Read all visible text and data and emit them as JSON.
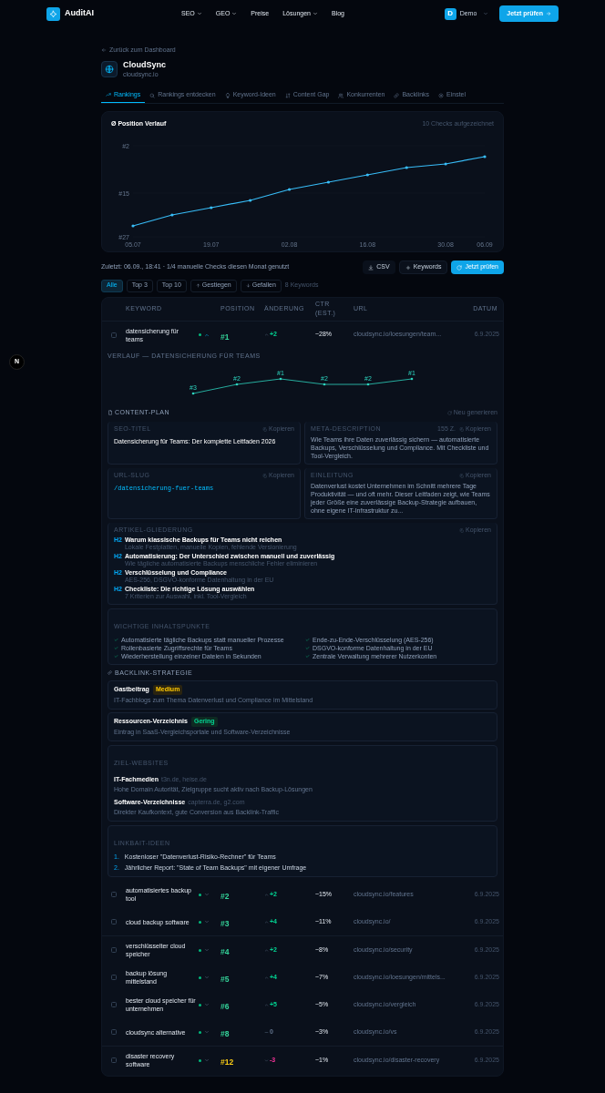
{
  "nav": {
    "brand": "AuditAI",
    "links": [
      {
        "label": "SEO",
        "dropdown": true
      },
      {
        "label": "GEO",
        "dropdown": true
      },
      {
        "label": "Preise",
        "dropdown": false
      },
      {
        "label": "Lösungen",
        "dropdown": true
      },
      {
        "label": "Blog",
        "dropdown": false
      }
    ],
    "avatar": "D",
    "user": "Demo",
    "cta": "Jetzt prüfen"
  },
  "back_link": "Zurück zum Dashboard",
  "project": {
    "name": "CloudSync",
    "domain": "cloudsync.io"
  },
  "tabs": [
    {
      "label": "Rankings",
      "selected": true
    },
    {
      "label": "Rankings entdecken",
      "selected": false
    },
    {
      "label": "Keyword-Ideen",
      "selected": false
    },
    {
      "label": "Content Gap",
      "selected": false
    },
    {
      "label": "Konkurrenten",
      "selected": false
    },
    {
      "label": "Backlinks",
      "selected": false
    },
    {
      "label": "Einstel",
      "selected": false
    }
  ],
  "position_chart": {
    "title": "Ø Position Verlauf",
    "note": "10 Checks aufgezeichnet",
    "chart_data": {
      "type": "line",
      "categories": [
        "05.07",
        null,
        "19.07",
        null,
        "02.08",
        null,
        "16.08",
        null,
        "30.08",
        "06.09"
      ],
      "series": [
        {
          "color": "#38bdf8",
          "values": [
            24,
            21,
            19,
            17,
            14,
            12,
            10,
            8,
            7,
            5
          ]
        }
      ],
      "ylim": [
        27,
        2
      ],
      "yticks": [
        {
          "value": 2,
          "label": "#2"
        },
        {
          "value": 15,
          "label": "#15"
        },
        {
          "value": 27,
          "label": "#27"
        }
      ]
    }
  },
  "toolbar": {
    "status": "Zuletzt: 06.09., 18:41 · 1/4 manuelle Checks diesen Monat genutzt",
    "buttons": [
      {
        "kind": "csv",
        "label": "CSV"
      },
      {
        "kind": "add",
        "label": "Keywords"
      },
      {
        "kind": "primary",
        "label": "Jetzt prüfen"
      }
    ]
  },
  "filters": [
    {
      "label": "Alle",
      "selected": true
    },
    {
      "label": "Top 3",
      "selected": false
    },
    {
      "label": "Top 10",
      "selected": false
    },
    {
      "label": "Gestiegen",
      "selected": false
    },
    {
      "label": "Gefallen",
      "selected": false
    }
  ],
  "keyword_count": "8 Keywords",
  "table": {
    "columns": [
      "KEYWORD",
      "POSITION",
      "ÄNDERUNG",
      "CTR (EST.)",
      "URL",
      "DATUM"
    ],
    "rows": [
      {
        "keyword": "datensicherung für teams",
        "position": "#1",
        "color": "#34d399",
        "kind": "up",
        "change": "+2",
        "ctr": "~28%",
        "url": "cloudsync.io/loesungen/team...",
        "date": "6.9.2025",
        "checked": false,
        "expanded": true
      },
      {
        "keyword": "automatisiertes backup tool",
        "position": "#2",
        "color": "#34d399",
        "kind": "up",
        "change": "+2",
        "ctr": "~15%",
        "url": "cloudsync.io/features",
        "date": "6.9.2025",
        "checked": false,
        "expanded": false
      },
      {
        "keyword": "cloud backup software",
        "position": "#3",
        "color": "#34d399",
        "kind": "up",
        "change": "+4",
        "ctr": "~11%",
        "url": "cloudsync.io/",
        "date": "6.9.2025",
        "checked": false,
        "expanded": false
      },
      {
        "keyword": "verschlüsselter cloud speicher",
        "position": "#4",
        "color": "#34d399",
        "kind": "up",
        "change": "+2",
        "ctr": "~8%",
        "url": "cloudsync.io/security",
        "date": "6.9.2025",
        "checked": false,
        "expanded": false
      },
      {
        "keyword": "backup lösung mittelstand",
        "position": "#5",
        "color": "#34d399",
        "kind": "up",
        "change": "+4",
        "ctr": "~7%",
        "url": "cloudsync.io/loesungen/mittels...",
        "date": "6.9.2025",
        "checked": false,
        "expanded": false
      },
      {
        "keyword": "bester cloud speicher für unternehmen",
        "position": "#6",
        "color": "#34d399",
        "kind": "up",
        "change": "+5",
        "ctr": "~5%",
        "url": "cloudsync.io/vergleich",
        "date": "6.9.2025",
        "checked": false,
        "expanded": false
      },
      {
        "keyword": "cloudsync alternative",
        "position": "#8",
        "color": "#34d399",
        "kind": "flat",
        "change": "0",
        "ctr": "~3%",
        "url": "cloudsync.io/vs",
        "date": "6.9.2025",
        "checked": false,
        "expanded": false
      },
      {
        "keyword": "disaster recovery software",
        "position": "#12",
        "color": "#facc15",
        "kind": "down",
        "change": "-3",
        "ctr": "~1%",
        "url": "cloudsync.io/disaster-recovery",
        "date": "6.9.2025",
        "checked": false,
        "expanded": false
      }
    ]
  },
  "history": {
    "title": "VERLAUF — DATENSICHERUNG FÜR TEAMS",
    "point_labels": [
      "#3",
      "#2",
      "#1",
      "#2",
      "#2",
      "#1"
    ]
  },
  "content_plan": {
    "title": "CONTENT-PLAN",
    "regenerate": "Neu generieren",
    "seo_title": {
      "label": "SEO-TITEL",
      "copy": "Kopieren",
      "text": "Datensicherung für Teams: Der komplette Leitfaden 2026"
    },
    "meta": {
      "label": "META-DESCRIPTION",
      "count": "155 Z.",
      "copy": "Kopieren",
      "text": "Wie Teams ihre Daten zuverlässig sichern — automatisierte Backups, Verschlüsselung und Compliance. Mit Checkliste und Tool-Vergleich."
    },
    "slug": {
      "label": "URL-SLUG",
      "copy": "Kopieren",
      "text": "/datensicherung-fuer-teams"
    },
    "intro": {
      "label": "EINLEITUNG",
      "copy": "Kopieren",
      "text": "Datenverlust kostet Unternehmen im Schnitt mehrere Tage Produktivität — und oft mehr. Dieser Leitfaden zeigt, wie Teams jeder Größe eine zuverlässige Backup-Strategie aufbauen, ohne eigene IT-Infrastruktur zu..."
    },
    "outline": {
      "label": "ARTIKEL-GLIEDERUNG",
      "copy": "Kopieren",
      "items": [
        {
          "tag": "H2",
          "heading": "Warum klassische Backups für Teams nicht reichen",
          "note": "Lokale Festplatten, manuelle Kopien, fehlende Versionierung"
        },
        {
          "tag": "H2",
          "heading": "Automatisierung: Der Unterschied zwischen manuell und zuverlässig",
          "note": "Wie tägliche automatisierte Backups menschliche Fehler eliminieren"
        },
        {
          "tag": "H2",
          "heading": "Verschlüsselung und Compliance",
          "note": "AES-256, DSGVO-konforme Datenhaltung in der EU"
        },
        {
          "tag": "H2",
          "heading": "Checkliste: Die richtige Lösung auswählen",
          "note": "7 Kriterien zur Auswahl, inkl. Tool-Vergleich"
        }
      ]
    },
    "key_points": {
      "label": "WICHTIGE INHALTSPUNKTE",
      "items": [
        "Automatisierte tägliche Backups statt manueller Prozesse",
        "Ende-zu-Ende-Verschlüsselung (AES-256)",
        "Rollenbasierte Zugriffsrechte für Teams",
        "DSGVO-konforme Datenhaltung in der EU",
        "Wiederherstellung einzelner Dateien in Sekunden",
        "Zentrale Verwaltung mehrerer Nutzerkonten"
      ]
    }
  },
  "backlinks": {
    "title": "BACKLINK-STRATEGIE",
    "tactics": [
      {
        "name": "Gastbeitrag",
        "effort": "Medium",
        "kind": "medium",
        "text": "IT-Fachblogs zum Thema Datenverlust und Compliance im Mittelstand"
      },
      {
        "name": "Ressourcen-Verzeichnis",
        "effort": "Gering",
        "kind": "low",
        "text": "Eintrag in SaaS-Vergleichsportale und Software-Verzeichnisse"
      }
    ],
    "targets": {
      "label": "ZIEL-WEBSITES",
      "items": [
        {
          "name": "IT-Fachmedien",
          "sites": "t3n.de, heise.de",
          "text": "Hohe Domain Autorität, Zielgruppe sucht aktiv nach Backup-Lösungen"
        },
        {
          "name": "Software-Verzeichnisse",
          "sites": "capterra.de, g2.com",
          "text": "Direkter Kaufkontext, gute Conversion aus Backlink-Traffic"
        }
      ]
    },
    "linkbait": {
      "label": "LINKBAIT-IDEEN",
      "items": [
        {
          "number": "1.",
          "text": "Kostenloser \"Datenverlust-Risiko-Rechner\" für Teams"
        },
        {
          "number": "2.",
          "text": "Jährlicher Report: \"State of Team Backups\" mit eigener Umfrage"
        }
      ]
    }
  },
  "dev_badge": "N"
}
